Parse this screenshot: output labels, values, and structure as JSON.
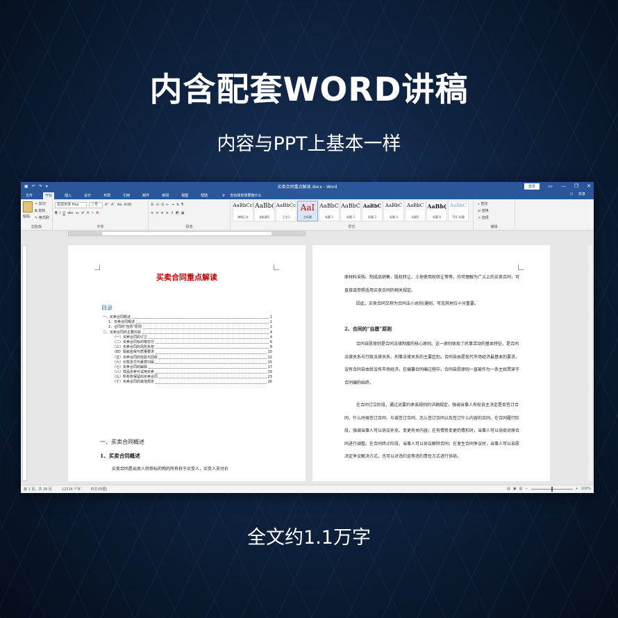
{
  "headline": "内含配套WORD讲稿",
  "subline": "内容与PPT上基本一样",
  "footline": "全文约1.1万字",
  "window": {
    "title": "买卖合同重点解读.docx - Word",
    "login": "登录",
    "share": "共享",
    "tabs": [
      "文件",
      "开始",
      "插入",
      "设计",
      "布局",
      "引用",
      "邮件",
      "审阅",
      "视图",
      "帮助"
    ],
    "active_tab": "开始",
    "tell_me": "告诉我你想要做什么"
  },
  "ribbon": {
    "clipboard": {
      "paste": "粘贴",
      "cut": "剪切",
      "copy": "复制",
      "format_painter": "格式刷",
      "label": "剪贴板"
    },
    "font": {
      "name": "思源宋体 Hea",
      "size": "二号",
      "label": "字体"
    },
    "paragraph": {
      "label": "段落"
    },
    "styles": {
      "label": "样式",
      "items": [
        {
          "sample": "AaBbCcI",
          "name": "弹格正文"
        },
        {
          "sample": "AaBb(",
          "name": "副标题1"
        },
        {
          "sample": "AaBbCc",
          "name": "正文1"
        },
        {
          "sample": "AaI",
          "name": "主标题"
        },
        {
          "sample": "AaBbC",
          "name": "标题 1"
        },
        {
          "sample": "AaBbC",
          "name": "标题 2"
        },
        {
          "sample": "AaBbC",
          "name": "标题 3"
        },
        {
          "sample": "AaBbC",
          "name": "标题 4"
        },
        {
          "sample": "AaBbC",
          "name": "标题5"
        },
        {
          "sample": "AaBb(",
          "name": "标题 6"
        },
        {
          "sample": "AaBbC",
          "name": "TOC 标题"
        }
      ]
    },
    "editing": {
      "find": "查找",
      "replace": "替换",
      "select": "选择",
      "label": "编辑"
    }
  },
  "page1": {
    "title": "买卖合同重点解读",
    "toc_title": "目录",
    "toc": [
      {
        "text": "一、买卖合同概述",
        "page": "1",
        "level": 0
      },
      {
        "text": "1、买卖合同概述",
        "page": "1",
        "level": 1
      },
      {
        "text": "2、合同的\"自愿\"原则",
        "page": "2",
        "level": 1
      },
      {
        "text": "二、买卖合同的主要内容",
        "page": "4",
        "level": 0
      },
      {
        "text": "（一）买卖合同的订立",
        "page": "4",
        "level": 2
      },
      {
        "text": "（二）买卖合同标的物交付",
        "page": "6",
        "level": 2
      },
      {
        "text": "（三）买卖合同的风险负担",
        "page": "8",
        "level": 2
      },
      {
        "text": "（四）瑕疵担保与质量要求",
        "page": "10",
        "level": 2
      },
      {
        "text": "（五）买卖合同的检验与回收",
        "page": "12",
        "level": 2
      },
      {
        "text": "（六）价款支付与暴意归属",
        "page": "15",
        "level": 2
      },
      {
        "text": "（七）买卖合同的解除",
        "page": "17",
        "level": 2
      },
      {
        "text": "（八）样品买卖与试用买卖",
        "page": "19",
        "level": 2
      },
      {
        "text": "（九）所有权保留的买卖合同",
        "page": "23",
        "level": 2
      },
      {
        "text": "（十）买卖合同的其他规定",
        "page": "26",
        "level": 2
      }
    ],
    "h1": "一、买卖合同概述",
    "h2": "1、买卖合同概述",
    "body": "买卖合同是出卖人转移标的物的所有权于买受人，买受人支付价"
  },
  "page2": {
    "para1": "原材料采购、制成品销售、股权转让、土地使用权转让等等，均可理解为广义上的买卖合同，可直接或参照适用买卖合同的相关规定。",
    "para2": "因此，买卖合同又称为合同法小总则/通则，可见其地位十分重要。",
    "heading": "2、合同的\"自愿\"原则",
    "para3": "合同自愿原则是合同法律制度的核心原则。这一原则体现了民事活动的基本特征，是合同法律关系与行政法律关系、刑事法律关系的主要区别。合同自由是现代市场经济最基本的要求，没有合同自由就没有市场经济。在编纂合同编过程中，合同自愿原则一直被作为一条主线贯穿于合同编的始终。",
    "para4": "在合同订立阶段，通过对要约承诺规则的详细规定，强调当事人有权自主决定是否签订合同、什么时候签订合同、与谁签订合同、怎么签订合同以及签订什么内容的合同。在合同履行阶段，强调当事人可以协议补充、变更有关内容；在有情势变更的情形时，当事人可以协商对原合同进行调整。在合同终止阶段，当事人可以协议解除合同；在发生合同争议时，当事人可以自愿决定争议解决方式，也可以对违约金等违约责任方式进行协商。"
  },
  "status": {
    "pages": "第 1 页，共 26 页",
    "words": "12316 个字",
    "lang": "中文(中国)",
    "zoom": "100%"
  }
}
